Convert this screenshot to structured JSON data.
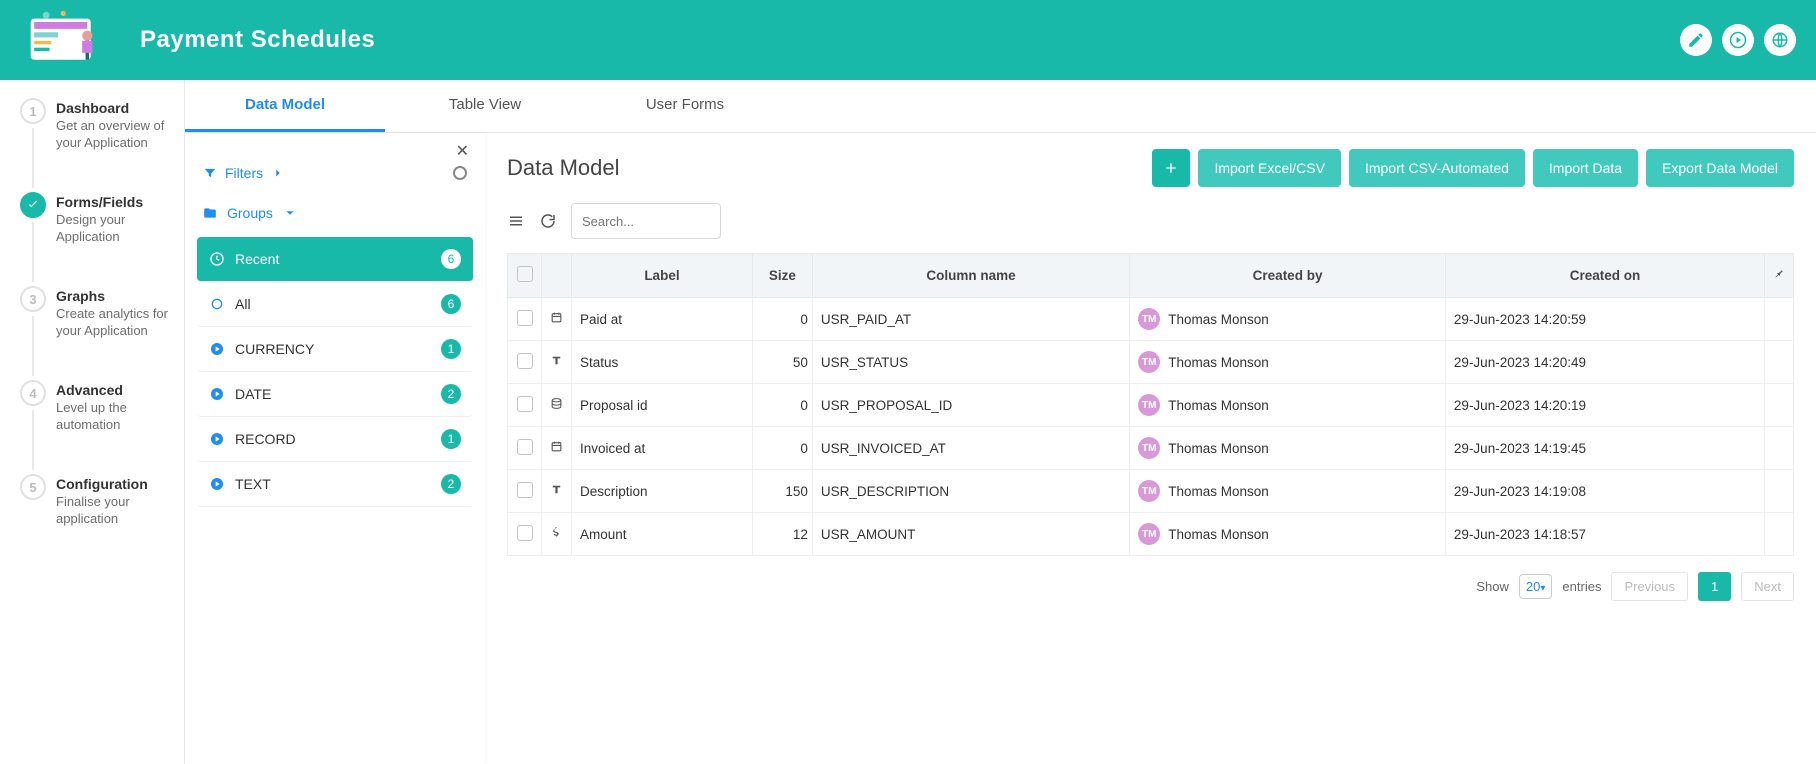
{
  "header": {
    "title": "Payment Schedules"
  },
  "steps": [
    {
      "num": "1",
      "title": "Dashboard",
      "sub": "Get an overview of your Application",
      "state": "default"
    },
    {
      "num": "✓",
      "title": "Forms/Fields",
      "sub": "Design your Application",
      "state": "done"
    },
    {
      "num": "3",
      "title": "Graphs",
      "sub": "Create analytics for your Application",
      "state": "default"
    },
    {
      "num": "4",
      "title": "Advanced",
      "sub": "Level up the automation",
      "state": "default"
    },
    {
      "num": "5",
      "title": "Configuration",
      "sub": "Finalise your application",
      "state": "default"
    }
  ],
  "tabs": [
    {
      "label": "Data Model",
      "active": true
    },
    {
      "label": "Table View",
      "active": false
    },
    {
      "label": "User Forms",
      "active": false
    }
  ],
  "filters_label": "Filters",
  "groups_label": "Groups",
  "groups": [
    {
      "icon": "clock",
      "label": "Recent",
      "count": "6",
      "active": true
    },
    {
      "icon": "circle",
      "label": "All",
      "count": "6"
    },
    {
      "icon": "play-circle",
      "label": "CURRENCY",
      "count": "1"
    },
    {
      "icon": "play-circle",
      "label": "DATE",
      "count": "2"
    },
    {
      "icon": "play-circle",
      "label": "RECORD",
      "count": "1"
    },
    {
      "icon": "play-circle",
      "label": "TEXT",
      "count": "2"
    }
  ],
  "content": {
    "heading": "Data Model",
    "buttons": {
      "import_excel": "Import Excel/CSV",
      "import_csv_auto": "Import CSV-Automated",
      "import_data": "Import Data",
      "export_model": "Export Data Model"
    },
    "search_placeholder": "Search..."
  },
  "table": {
    "headers": {
      "label": "Label",
      "size": "Size",
      "column": "Column name",
      "created_by": "Created by",
      "created_on": "Created on"
    },
    "rows": [
      {
        "type": "calendar",
        "label": "Paid at",
        "size": "0",
        "column": "USR_PAID_AT",
        "initials": "TM",
        "creator": "Thomas Monson",
        "created_on": "29-Jun-2023 14:20:59"
      },
      {
        "type": "text",
        "label": "Status",
        "size": "50",
        "column": "USR_STATUS",
        "initials": "TM",
        "creator": "Thomas Monson",
        "created_on": "29-Jun-2023 14:20:49"
      },
      {
        "type": "db",
        "label": "Proposal id",
        "size": "0",
        "column": "USR_PROPOSAL_ID",
        "initials": "TM",
        "creator": "Thomas Monson",
        "created_on": "29-Jun-2023 14:20:19"
      },
      {
        "type": "calendar",
        "label": "Invoiced at",
        "size": "0",
        "column": "USR_INVOICED_AT",
        "initials": "TM",
        "creator": "Thomas Monson",
        "created_on": "29-Jun-2023 14:19:45"
      },
      {
        "type": "text",
        "label": "Description",
        "size": "150",
        "column": "USR_DESCRIPTION",
        "initials": "TM",
        "creator": "Thomas Monson",
        "created_on": "29-Jun-2023 14:19:08"
      },
      {
        "type": "dollar",
        "label": "Amount",
        "size": "12",
        "column": "USR_AMOUNT",
        "initials": "TM",
        "creator": "Thomas Monson",
        "created_on": "29-Jun-2023 14:18:57"
      }
    ]
  },
  "pager": {
    "show": "Show",
    "page_size": "20",
    "entries": "entries",
    "prev": "Previous",
    "current": "1",
    "next": "Next"
  }
}
